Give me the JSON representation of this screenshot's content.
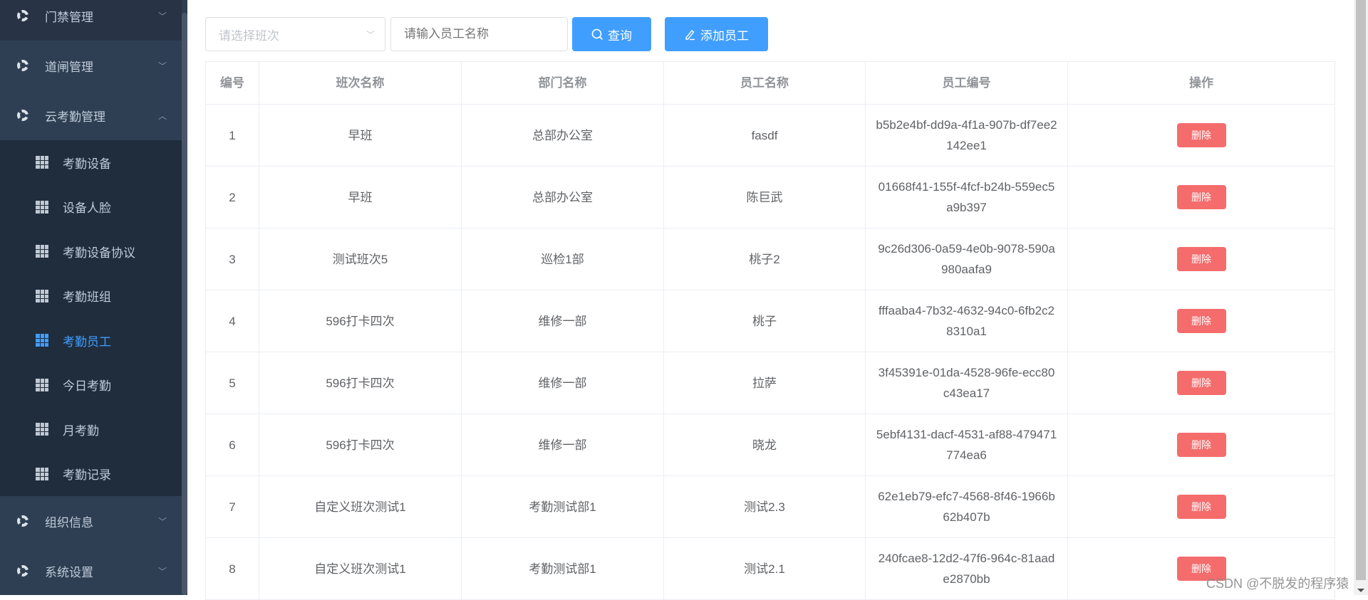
{
  "sidebar": {
    "parents": [
      {
        "label": "门禁管理",
        "expanded": false
      },
      {
        "label": "道闸管理",
        "expanded": false
      },
      {
        "label": "云考勤管理",
        "expanded": true
      },
      {
        "label": "组织信息",
        "expanded": false
      },
      {
        "label": "系统设置",
        "expanded": false
      }
    ],
    "sub_items": [
      "考勤设备",
      "设备人脸",
      "考勤设备协议",
      "考勤班组",
      "考勤员工",
      "今日考勤",
      "月考勤",
      "考勤记录"
    ],
    "active_sub": "考勤员工"
  },
  "filters": {
    "shift_placeholder": "请选择班次",
    "name_placeholder": "请输入员工名称",
    "query_label": "查询",
    "add_label": "添加员工"
  },
  "table": {
    "headers": [
      "编号",
      "班次名称",
      "部门名称",
      "员工名称",
      "员工编号",
      "操作"
    ],
    "rows": [
      [
        "1",
        "早班",
        "总部办公室",
        "fasdf",
        "b5b2e4bf-dd9a-4f1a-907b-df7ee2142ee1"
      ],
      [
        "2",
        "早班",
        "总部办公室",
        "陈巨武",
        "01668f41-155f-4fcf-b24b-559ec5a9b397"
      ],
      [
        "3",
        "测试班次5",
        "巡检1部",
        "桃子2",
        "9c26d306-0a59-4e0b-9078-590a980aafa9"
      ],
      [
        "4",
        "596打卡四次",
        "维修一部",
        "桃子",
        "fffaaba4-7b32-4632-94c0-6fb2c28310a1"
      ],
      [
        "5",
        "596打卡四次",
        "维修一部",
        "拉萨",
        "3f45391e-01da-4528-96fe-ecc80c43ea17"
      ],
      [
        "6",
        "596打卡四次",
        "维修一部",
        "晓龙",
        "5ebf4131-dacf-4531-af88-479471774ea6"
      ],
      [
        "7",
        "自定义班次测试1",
        "考勤测试部1",
        "测试2.3",
        "62e1eb79-efc7-4568-8f46-1966b62b407b"
      ],
      [
        "8",
        "自定义班次测试1",
        "考勤测试部1",
        "测试2.1",
        "240fcae8-12d2-47f6-964c-81aade2870bb"
      ]
    ],
    "delete_label": "删除"
  },
  "watermark": "CSDN @不脱发的程序猿",
  "colors": {
    "primary": "#409eff",
    "danger": "#f56c6c",
    "sidebar": "#2e3d51",
    "submenu": "#1f2d3d"
  }
}
